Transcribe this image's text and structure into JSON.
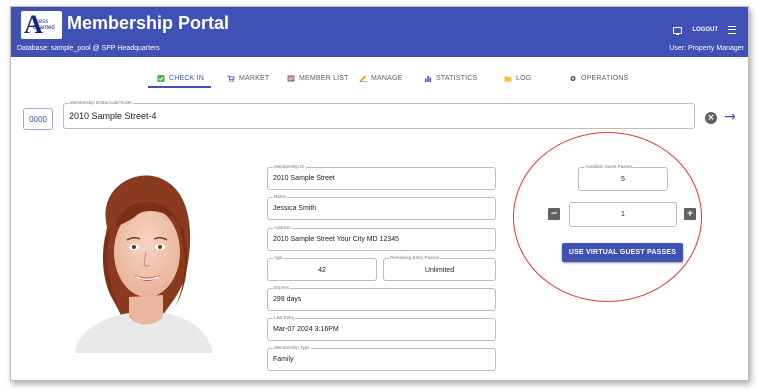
{
  "header": {
    "logo_big": "A",
    "logo_small": "ccess Granted",
    "title": "Membership Portal",
    "database_line": "Database: sample_pool @ SPP Headquarters",
    "user_line": "User: Property Manager",
    "logout_label": "LOGOUT"
  },
  "tabs": [
    {
      "label": "CHECK IN",
      "icon": "check-box-icon",
      "color": "#4caf50",
      "active": true
    },
    {
      "label": "MARKET",
      "icon": "cart-icon",
      "color": "#3f51b5"
    },
    {
      "label": "MEMBER LIST",
      "icon": "list-icon",
      "color": "#795548"
    },
    {
      "label": "MANAGE",
      "icon": "pencil-icon",
      "color": "#ff9800"
    },
    {
      "label": "STATISTICS",
      "icon": "bar-chart-icon",
      "color": "#3f51b5"
    },
    {
      "label": "LOG",
      "icon": "folder-icon",
      "color": "#fbc02d"
    },
    {
      "label": "OPERATIONS",
      "icon": "gear-icon",
      "color": "#616161"
    }
  ],
  "search": {
    "scan_button": "0000",
    "label": "Membership ID/Barcode/Ticket",
    "value": "2010 Sample Street-4"
  },
  "member": {
    "membership_id": {
      "label": "Membership ID",
      "value": "2010 Sample Street"
    },
    "name": {
      "label": "Name",
      "value": "Jessica Smith"
    },
    "address": {
      "label": "Address",
      "value": "2010 Sample Street Your City MD 12345"
    },
    "age": {
      "label": "Age",
      "value": "42"
    },
    "remaining": {
      "label": "Remaining Entry Passes",
      "value": "Unlimited"
    },
    "expires": {
      "label": "Expires",
      "value": "299 days"
    },
    "last_entry": {
      "label": "Last Entry",
      "value": "Mar-07 2024 3:16PM"
    },
    "membership_type": {
      "label": "Membership Type",
      "value": "Family"
    }
  },
  "guest": {
    "available_label": "Available Guest Passes",
    "available_value": "5",
    "quantity": "1",
    "minus": "−",
    "plus": "+",
    "use_button": "USE VIRTUAL GUEST PASSES"
  },
  "colors": {
    "brand": "#3f51b5",
    "annotation": "#e53935"
  }
}
